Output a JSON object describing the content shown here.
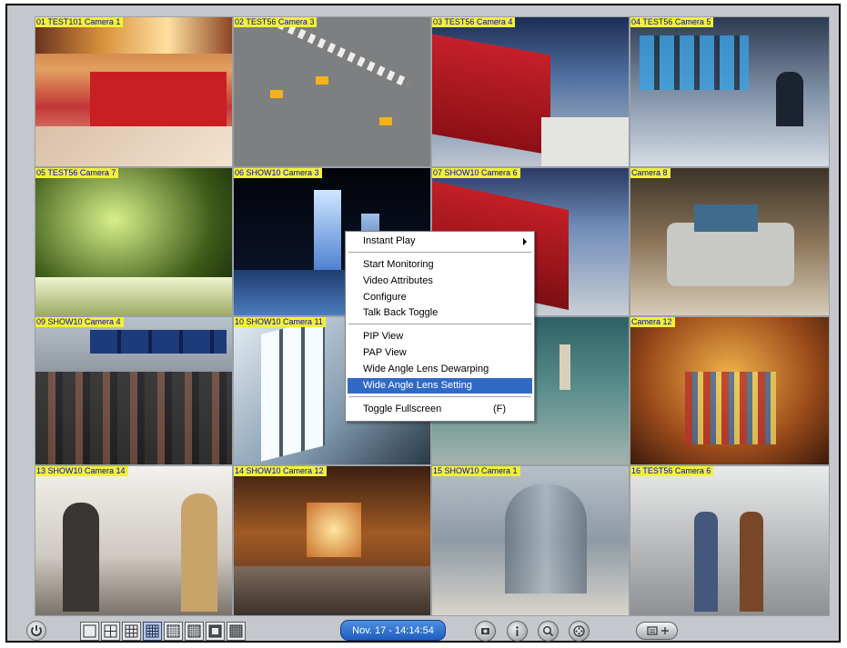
{
  "cameras": [
    {
      "label": "01 TEST101 Camera 1"
    },
    {
      "label": "02 TEST56 Camera 3"
    },
    {
      "label": "03 TEST56 Camera 4"
    },
    {
      "label": "04 TEST56 Camera 5"
    },
    {
      "label": "05 TEST56 Camera 7"
    },
    {
      "label": "06 SHOW10 Camera 3"
    },
    {
      "label": "07 SHOW10 Camera 6"
    },
    {
      "label": "Camera 8"
    },
    {
      "label": "09 SHOW10 Camera 4"
    },
    {
      "label": "10 SHOW10 Camera 11"
    },
    {
      "label": ""
    },
    {
      "label": "Camera 12"
    },
    {
      "label": "13 SHOW10 Camera 14"
    },
    {
      "label": "14 SHOW10 Camera 12"
    },
    {
      "label": "15 SHOW10 Camera 1"
    },
    {
      "label": "16 TEST56 Camera 6"
    }
  ],
  "context_menu": {
    "instant_play": "Instant Play",
    "start_monitoring": "Start Monitoring",
    "video_attributes": "Video Attributes",
    "configure": "Configure",
    "talk_back_toggle": "Talk Back Toggle",
    "pip_view": "PIP View",
    "pap_view": "PAP View",
    "wide_angle_dewarping": "Wide Angle Lens Dewarping",
    "wide_angle_setting": "Wide Angle Lens Setting",
    "toggle_fullscreen": "Toggle Fullscreen",
    "toggle_fullscreen_shortcut": "(F)",
    "selected_item": "Wide Angle Lens Setting"
  },
  "toolbar": {
    "datetime": "Nov. 17 - 14:14:54",
    "layouts": [
      "1x1",
      "2x2",
      "3x3",
      "4x4",
      "5x5",
      "6x6",
      "1+5",
      "8x8"
    ],
    "selected_layout": "4x4",
    "icons": [
      "power-icon",
      "snapshot-icon",
      "info-icon",
      "search-icon",
      "film-reel-icon",
      "camera-sequence-icon"
    ]
  },
  "colors": {
    "label_bg": "#f2f233",
    "label_text": "#0000c8",
    "menu_highlight": "#316ac5",
    "date_box": "#1e5cc0"
  }
}
